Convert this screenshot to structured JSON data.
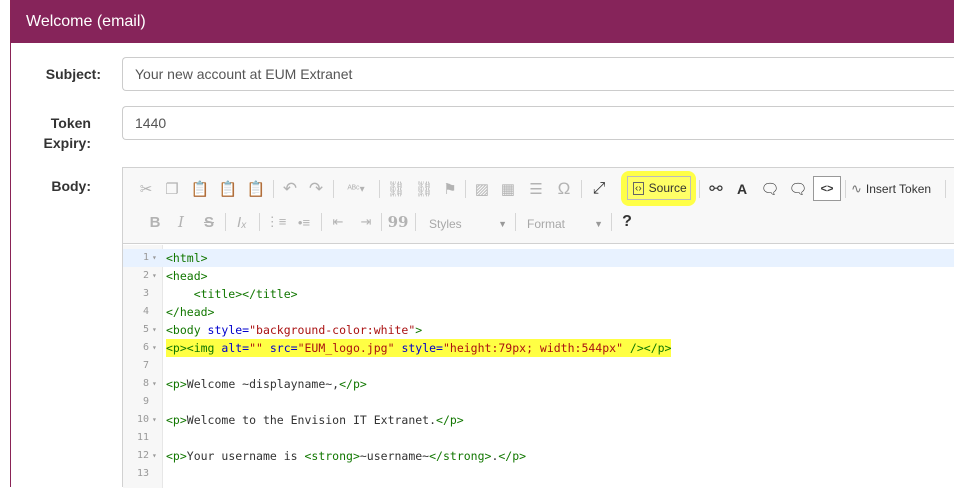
{
  "panel": {
    "title": "Welcome (email)"
  },
  "subject": {
    "label": "Subject:",
    "value": "Your new account at EUM Extranet"
  },
  "token": {
    "label_line1": "Token",
    "label_line2": "Expiry:",
    "value": "1440"
  },
  "body": {
    "label": "Body:"
  },
  "toolbar": {
    "source_label": "Source",
    "insert_token_label": "Insert Token",
    "styles_label": "Styles",
    "format_label": "Format",
    "help_label": "?",
    "special_char": "Ω",
    "quote_label": "99"
  },
  "code_lines": [
    {
      "n": "1",
      "fold": "▾"
    },
    {
      "n": "2",
      "fold": "▾"
    },
    {
      "n": "3",
      "fold": ""
    },
    {
      "n": "4",
      "fold": ""
    },
    {
      "n": "5",
      "fold": "▾"
    },
    {
      "n": "6",
      "fold": "▾"
    },
    {
      "n": "7",
      "fold": ""
    },
    {
      "n": "8",
      "fold": "▾"
    },
    {
      "n": "9",
      "fold": ""
    },
    {
      "n": "10",
      "fold": "▾"
    },
    {
      "n": "11",
      "fold": ""
    },
    {
      "n": "12",
      "fold": "▾"
    },
    {
      "n": "13",
      "fold": ""
    }
  ],
  "code": {
    "l1": "<html>",
    "l2": "<head>",
    "l3": "    <title></title>",
    "l4": "</head>",
    "l5_tag": "<body",
    "l5_attr": " style=",
    "l5_str": "\"background-color:white\"",
    "l5_end": ">",
    "l6_a": "<p><img",
    "l6_b": " alt=",
    "l6_c": "\"\"",
    "l6_d": " src=",
    "l6_e": "\"EUM_logo.jpg\"",
    "l6_f": " style=",
    "l6_g": "\"height:79px; width:544px\"",
    "l6_h": " /></p>",
    "l8_a": "<p>",
    "l8_b": "Welcome ~displayname~,",
    "l8_c": "</p>",
    "l10_a": "<p>",
    "l10_b": "Welcome to the Envision IT Extranet.",
    "l10_c": "</p>",
    "l12_a": "<p>",
    "l12_b": "Your username is ",
    "l12_c": "<strong>",
    "l12_d": "~username~",
    "l12_e": "</strong>",
    "l12_f": ".",
    "l12_g": "</p>"
  }
}
